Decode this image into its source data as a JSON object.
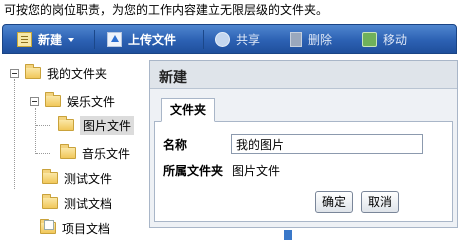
{
  "caption": "可按您的岗位职责，为您的工作内容建立无限层级的文件夹。",
  "toolbar": {
    "new_label": "新建",
    "new_icon": "new-doc-icon",
    "upload_label": "上传文件",
    "upload_icon": "upload-icon",
    "share_label": "共享",
    "share_icon": "share-icon",
    "delete_label": "删除",
    "delete_icon": "trash-icon",
    "move_label": "移动",
    "move_icon": "move-icon"
  },
  "tree": {
    "root": "我的文件夹",
    "entertainment": "娱乐文件",
    "pictures": "图片文件",
    "music": "音乐文件",
    "test_file": "测试文件",
    "test_doc": "测试文档",
    "project_doc": "项目文档"
  },
  "panel": {
    "title": "新建",
    "tab": "文件夹",
    "name_label": "名称",
    "name_value": "我的图片",
    "parent_label": "所属文件夹",
    "parent_value": "图片文件",
    "ok_label": "确定",
    "cancel_label": "取消"
  },
  "colors": {
    "toolbar_top": "#4f86cf",
    "toolbar_bottom": "#1f4f9c",
    "panel_bg": "#eef1f5"
  }
}
